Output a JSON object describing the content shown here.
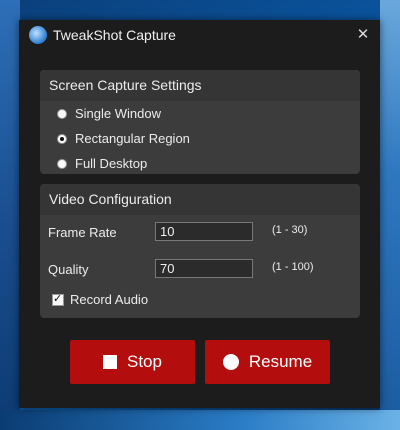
{
  "window": {
    "title": "TweakShot Capture",
    "close_glyph": "✕",
    "icon": "app-camera-icon"
  },
  "capture_settings": {
    "heading": "Screen Capture Settings",
    "options": [
      {
        "label": "Single Window",
        "selected": false
      },
      {
        "label": "Rectangular Region",
        "selected": true
      },
      {
        "label": "Full Desktop",
        "selected": false
      }
    ]
  },
  "video_config": {
    "heading": "Video Configuration",
    "frame_rate": {
      "label": "Frame Rate",
      "value": "10",
      "range": "(1 - 30)"
    },
    "quality": {
      "label": "Quality",
      "value": "70",
      "range": "(1 - 100)"
    },
    "record_audio": {
      "label": "Record Audio",
      "checked": true
    }
  },
  "buttons": {
    "stop_label": "Stop",
    "resume_label": "Resume"
  },
  "colors": {
    "accent": "#b30d0d",
    "window_bg": "#1c1c1c",
    "panel_bg": "#3c3c3c"
  }
}
